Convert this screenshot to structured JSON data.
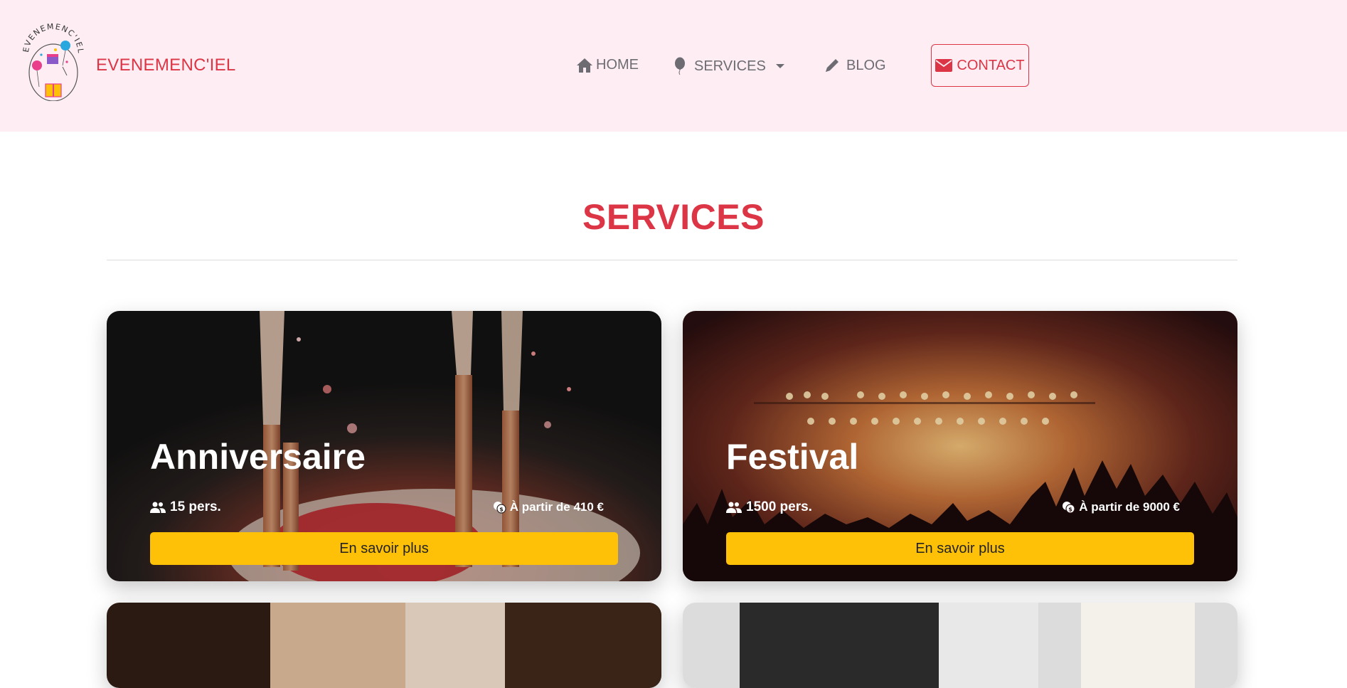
{
  "header": {
    "brand": "EVENEMENC'IEL",
    "logo_text": "EVENEMENC'IEL",
    "nav": {
      "home": "HOME",
      "services": "SERVICES",
      "blog": "BLOG",
      "contact": "CONTACT"
    },
    "icons": {
      "home": "home-icon",
      "services": "balloon-icon",
      "blog": "pencil-icon",
      "contact": "envelope-icon"
    }
  },
  "section": {
    "title": "SERVICES"
  },
  "cards": [
    {
      "title": "Anniversaire",
      "people": "15 pers.",
      "price": "À partir de 410 €",
      "button": "En savoir plus"
    },
    {
      "title": "Festival",
      "people": "1500 pers.",
      "price": "À partir de 9000 €",
      "button": "En savoir plus"
    }
  ],
  "colors": {
    "accent": "#dc3545",
    "header_bg": "#feeef3",
    "button": "#ffc107"
  }
}
